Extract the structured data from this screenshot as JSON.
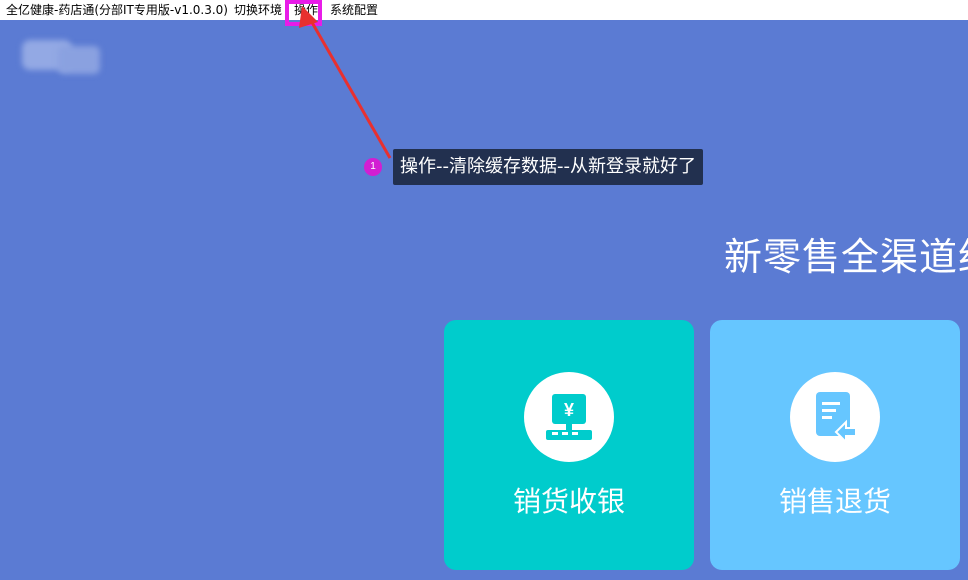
{
  "window": {
    "title": "全亿健康-药店通(分部IT专用版-v1.0.3.0)"
  },
  "menu": {
    "switch_env": "切换环境",
    "operations": "操作",
    "system_config": "系统配置"
  },
  "annotation": {
    "step_number": "1",
    "text": "操作--清除缓存数据--从新登录就好了",
    "highlight_color": "#e81ce8",
    "arrow_color": "#e8302f"
  },
  "main": {
    "headline": "新零售全渠道约"
  },
  "cards": [
    {
      "label": "销货收银",
      "icon": "cash-register-icon",
      "color": "#00cccc"
    },
    {
      "label": "销售退货",
      "icon": "return-document-icon",
      "color": "#66c6ff"
    }
  ],
  "colors": {
    "background": "#5b7bd3",
    "menubar": "#ffffff",
    "tooltip_bg": "#22304f"
  }
}
